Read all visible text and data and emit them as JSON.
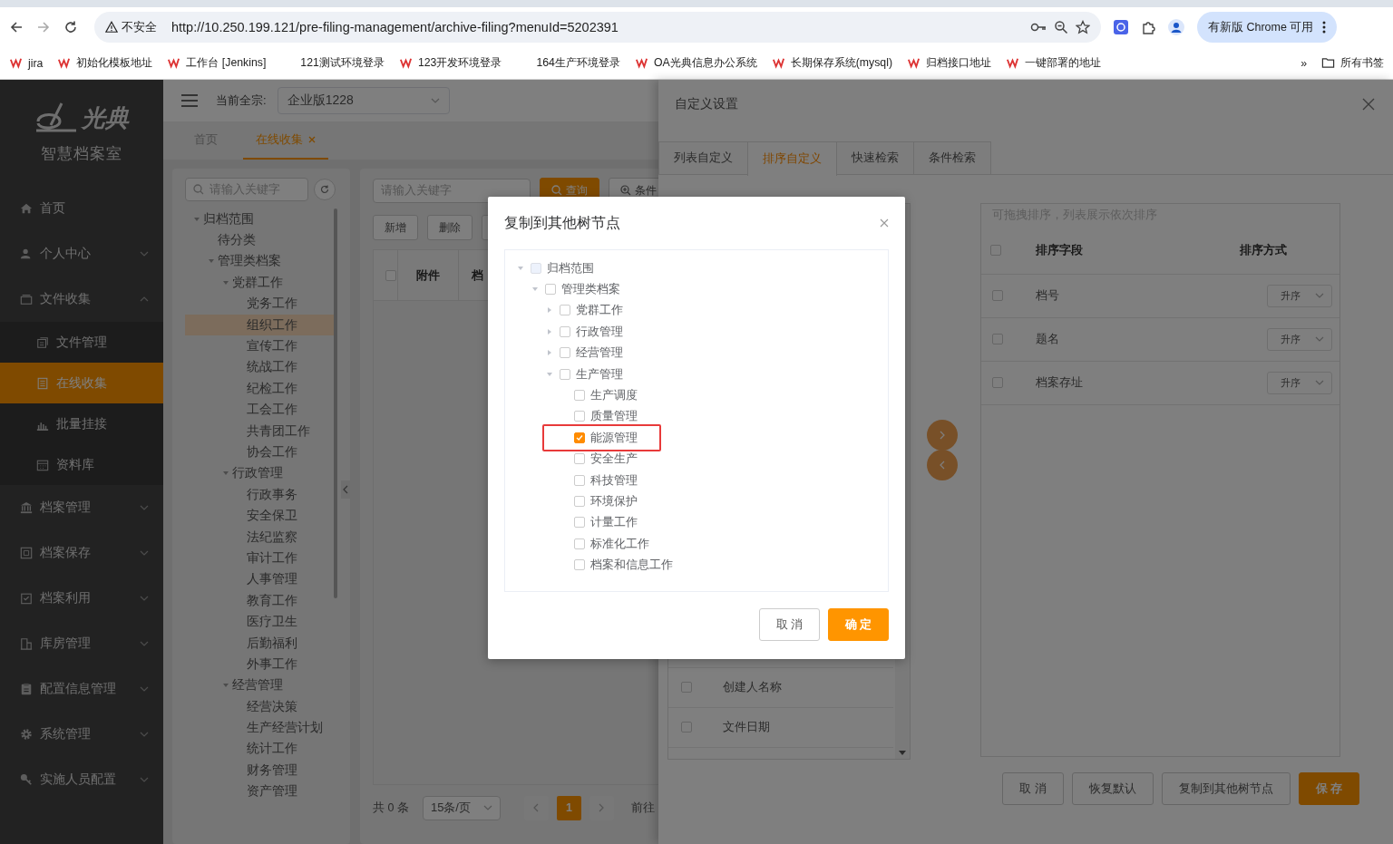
{
  "browser": {
    "security_label": "不安全",
    "url": "http://10.250.199.121/pre-filing-management/archive-filing?menuId=5202391",
    "update_button": "有新版 Chrome 可用",
    "bookmarks": [
      {
        "label": "jira",
        "icon": true
      },
      {
        "label": "初始化模板地址",
        "icon": true
      },
      {
        "label": "工作台 [Jenkins]",
        "icon": true
      },
      {
        "label": "121测试环境登录",
        "icon": false
      },
      {
        "label": "123开发环境登录",
        "icon": true
      },
      {
        "label": "164生产环境登录",
        "icon": false
      },
      {
        "label": "OA光典信息办公系统",
        "icon": true
      },
      {
        "label": "长期保存系统(mysql)",
        "icon": true
      },
      {
        "label": "归档接口地址",
        "icon": true
      },
      {
        "label": "一键部署的地址",
        "icon": true
      }
    ],
    "more": "»",
    "all_bookmarks": "所有书签"
  },
  "sidebar": {
    "logo_text": "光典",
    "subtitle": "智慧档案室",
    "menu": [
      {
        "label": "首页",
        "kind": "link",
        "selected": false
      },
      {
        "label": "个人中心",
        "kind": "group",
        "expanded": false,
        "selected": false
      },
      {
        "label": "文件收集",
        "kind": "group",
        "expanded": true,
        "selected": false,
        "children": [
          {
            "label": "文件管理",
            "selected": false
          },
          {
            "label": "在线收集",
            "selected": true
          },
          {
            "label": "批量挂接",
            "selected": false
          },
          {
            "label": "资料库",
            "selected": false
          }
        ]
      },
      {
        "label": "档案管理",
        "kind": "group",
        "expanded": false,
        "selected": false
      },
      {
        "label": "档案保存",
        "kind": "group",
        "expanded": false,
        "selected": false
      },
      {
        "label": "档案利用",
        "kind": "group",
        "expanded": false,
        "selected": false
      },
      {
        "label": "库房管理",
        "kind": "group",
        "expanded": false,
        "selected": false
      },
      {
        "label": "配置信息管理",
        "kind": "group",
        "expanded": false,
        "selected": false
      },
      {
        "label": "系统管理",
        "kind": "group",
        "expanded": false,
        "selected": false
      },
      {
        "label": "实施人员配置",
        "kind": "group",
        "expanded": false,
        "selected": false
      }
    ]
  },
  "header": {
    "fonds_label": "当前全宗:",
    "fonds_value": "企业版1228"
  },
  "page_tabs": [
    {
      "label": "首页",
      "selected": false,
      "closable": false
    },
    {
      "label": "在线收集",
      "selected": true,
      "closable": true
    }
  ],
  "category_tree": {
    "placeholder": "请输入关键字",
    "nodes": [
      {
        "label": "归档范围",
        "kind": "branch",
        "expanded": true,
        "selected": false,
        "children": [
          {
            "label": "待分类",
            "kind": "leaf",
            "selected": false
          },
          {
            "label": "管理类档案",
            "kind": "branch",
            "expanded": true,
            "selected": false,
            "children": [
              {
                "label": "党群工作",
                "kind": "branch",
                "expanded": true,
                "selected": false,
                "children": [
                  {
                    "label": "党务工作",
                    "kind": "leaf",
                    "selected": false
                  },
                  {
                    "label": "组织工作",
                    "kind": "leaf",
                    "selected": true
                  },
                  {
                    "label": "宣传工作",
                    "kind": "leaf",
                    "selected": false
                  },
                  {
                    "label": "统战工作",
                    "kind": "leaf",
                    "selected": false
                  },
                  {
                    "label": "纪检工作",
                    "kind": "leaf",
                    "selected": false
                  },
                  {
                    "label": "工会工作",
                    "kind": "leaf",
                    "selected": false
                  },
                  {
                    "label": "共青团工作",
                    "kind": "leaf",
                    "selected": false
                  },
                  {
                    "label": "协会工作",
                    "kind": "leaf",
                    "selected": false
                  }
                ]
              },
              {
                "label": "行政管理",
                "kind": "branch",
                "expanded": true,
                "selected": false,
                "children": [
                  {
                    "label": "行政事务",
                    "kind": "leaf",
                    "selected": false
                  },
                  {
                    "label": "安全保卫",
                    "kind": "leaf",
                    "selected": false
                  },
                  {
                    "label": "法纪监察",
                    "kind": "leaf",
                    "selected": false
                  },
                  {
                    "label": "审计工作",
                    "kind": "leaf",
                    "selected": false
                  },
                  {
                    "label": "人事管理",
                    "kind": "leaf",
                    "selected": false
                  },
                  {
                    "label": "教育工作",
                    "kind": "leaf",
                    "selected": false
                  },
                  {
                    "label": "医疗卫生",
                    "kind": "leaf",
                    "selected": false
                  },
                  {
                    "label": "后勤福利",
                    "kind": "leaf",
                    "selected": false
                  },
                  {
                    "label": "外事工作",
                    "kind": "leaf",
                    "selected": false
                  }
                ]
              },
              {
                "label": "经营管理",
                "kind": "branch",
                "expanded": true,
                "selected": false,
                "children": [
                  {
                    "label": "经营决策",
                    "kind": "leaf",
                    "selected": false
                  },
                  {
                    "label": "生产经营计划",
                    "kind": "leaf",
                    "selected": false
                  },
                  {
                    "label": "统计工作",
                    "kind": "leaf",
                    "selected": false
                  },
                  {
                    "label": "财务管理",
                    "kind": "leaf",
                    "selected": false
                  },
                  {
                    "label": "资产管理",
                    "kind": "leaf",
                    "selected": false
                  }
                ]
              }
            ]
          }
        ]
      }
    ]
  },
  "list_view": {
    "search_placeholder": "请输入关键字",
    "search_button": "查询",
    "filter_button": "条件",
    "actions": [
      "新增",
      "删除"
    ],
    "header_checked": false,
    "columns": [
      "附件",
      "档"
    ],
    "pagination": {
      "total": "共 0 条",
      "page_size": "15条/页",
      "current_page": "1",
      "goto_label": "前往"
    }
  },
  "settings_drawer": {
    "title": "自定义设置",
    "tabs": [
      {
        "label": "列表自定义",
        "selected": false
      },
      {
        "label": "排序自定义",
        "selected": true
      },
      {
        "label": "快速检索",
        "selected": false
      },
      {
        "label": "条件检索",
        "selected": false
      }
    ],
    "field_list": [
      {
        "label": "创建人名称",
        "checked": false
      },
      {
        "label": "文件日期",
        "checked": false
      }
    ],
    "sort_panel": {
      "hint": "可拖拽排序，列表展示依次排序",
      "header_checked": false,
      "columns": [
        "排序字段",
        "排序方式"
      ],
      "rows": [
        {
          "field": "档号",
          "order": "升序",
          "checked": false
        },
        {
          "field": "题名",
          "order": "升序",
          "checked": false
        },
        {
          "field": "档案存址",
          "order": "升序",
          "checked": false
        }
      ]
    },
    "buttons": [
      {
        "label": "取 消",
        "kind": "default"
      },
      {
        "label": "恢复默认",
        "kind": "default"
      },
      {
        "label": "复制到其他树节点",
        "kind": "default"
      },
      {
        "label": "保 存",
        "kind": "primary"
      }
    ]
  },
  "dialog": {
    "title": "复制到其他树节点",
    "nodes": [
      {
        "label": "归档范围",
        "kind": "branch",
        "expanded": true,
        "checked": false,
        "disabled": true,
        "highlighted": false,
        "children": [
          {
            "label": "管理类档案",
            "kind": "branch",
            "expanded": true,
            "checked": false,
            "disabled": false,
            "highlighted": false,
            "children": [
              {
                "label": "党群工作",
                "kind": "branch",
                "expanded": false,
                "checked": false,
                "disabled": false,
                "highlighted": false
              },
              {
                "label": "行政管理",
                "kind": "branch",
                "expanded": false,
                "checked": false,
                "disabled": false,
                "highlighted": false
              },
              {
                "label": "经营管理",
                "kind": "branch",
                "expanded": false,
                "checked": false,
                "disabled": false,
                "highlighted": false
              },
              {
                "label": "生产管理",
                "kind": "branch",
                "expanded": true,
                "checked": false,
                "disabled": false,
                "highlighted": false,
                "children": [
                  {
                    "label": "生产调度",
                    "kind": "leaf",
                    "checked": false,
                    "disabled": false,
                    "highlighted": false
                  },
                  {
                    "label": "质量管理",
                    "kind": "leaf",
                    "checked": false,
                    "disabled": false,
                    "highlighted": false
                  },
                  {
                    "label": "能源管理",
                    "kind": "leaf",
                    "checked": true,
                    "disabled": false,
                    "highlighted": true
                  },
                  {
                    "label": "安全生产",
                    "kind": "leaf",
                    "checked": false,
                    "disabled": false,
                    "highlighted": false
                  },
                  {
                    "label": "科技管理",
                    "kind": "leaf",
                    "checked": false,
                    "disabled": false,
                    "highlighted": false
                  },
                  {
                    "label": "环境保护",
                    "kind": "leaf",
                    "checked": false,
                    "disabled": false,
                    "highlighted": false
                  },
                  {
                    "label": "计量工作",
                    "kind": "leaf",
                    "checked": false,
                    "disabled": false,
                    "highlighted": false
                  },
                  {
                    "label": "标准化工作",
                    "kind": "leaf",
                    "checked": false,
                    "disabled": false,
                    "highlighted": false
                  },
                  {
                    "label": "档案和信息工作",
                    "kind": "leaf",
                    "checked": false,
                    "disabled": false,
                    "highlighted": false
                  }
                ]
              }
            ]
          }
        ]
      }
    ],
    "buttons": [
      {
        "label": "取 消",
        "kind": "default"
      },
      {
        "label": "确 定",
        "kind": "primary"
      }
    ]
  }
}
